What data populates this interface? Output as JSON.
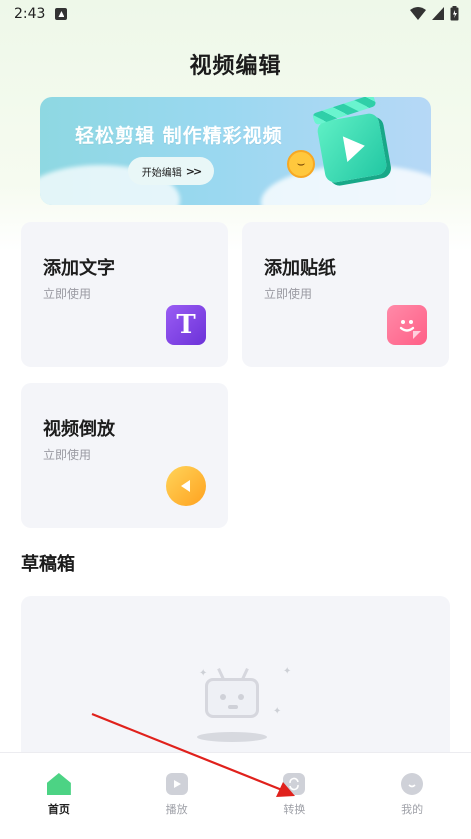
{
  "status_bar": {
    "time": "2:43"
  },
  "header": {
    "title": "视频编辑"
  },
  "banner": {
    "headline": "轻松剪辑 制作精彩视频",
    "cta_label": "开始编辑",
    "cta_icon": "double-chevron-right-icon"
  },
  "tools": [
    {
      "title": "添加文字",
      "subtitle": "立即使用",
      "icon": "text-T-icon",
      "glyph": "T",
      "color": "#7b45e6"
    },
    {
      "title": "添加贴纸",
      "subtitle": "立即使用",
      "icon": "sticker-smile-icon",
      "color": "#ff6f93"
    },
    {
      "title": "视频倒放",
      "subtitle": "立即使用",
      "icon": "reverse-play-icon",
      "color": "#ffb62f"
    }
  ],
  "drafts": {
    "title": "草稿箱"
  },
  "bottom_nav": {
    "items": [
      {
        "label": "首页",
        "icon": "home-icon",
        "active": true
      },
      {
        "label": "播放",
        "icon": "play-icon",
        "active": false
      },
      {
        "label": "转换",
        "icon": "convert-icon",
        "active": false
      },
      {
        "label": "我的",
        "icon": "profile-icon",
        "active": false
      }
    ]
  },
  "colors": {
    "accent_green": "#4cd384",
    "annotation_arrow": "#e0211c"
  }
}
